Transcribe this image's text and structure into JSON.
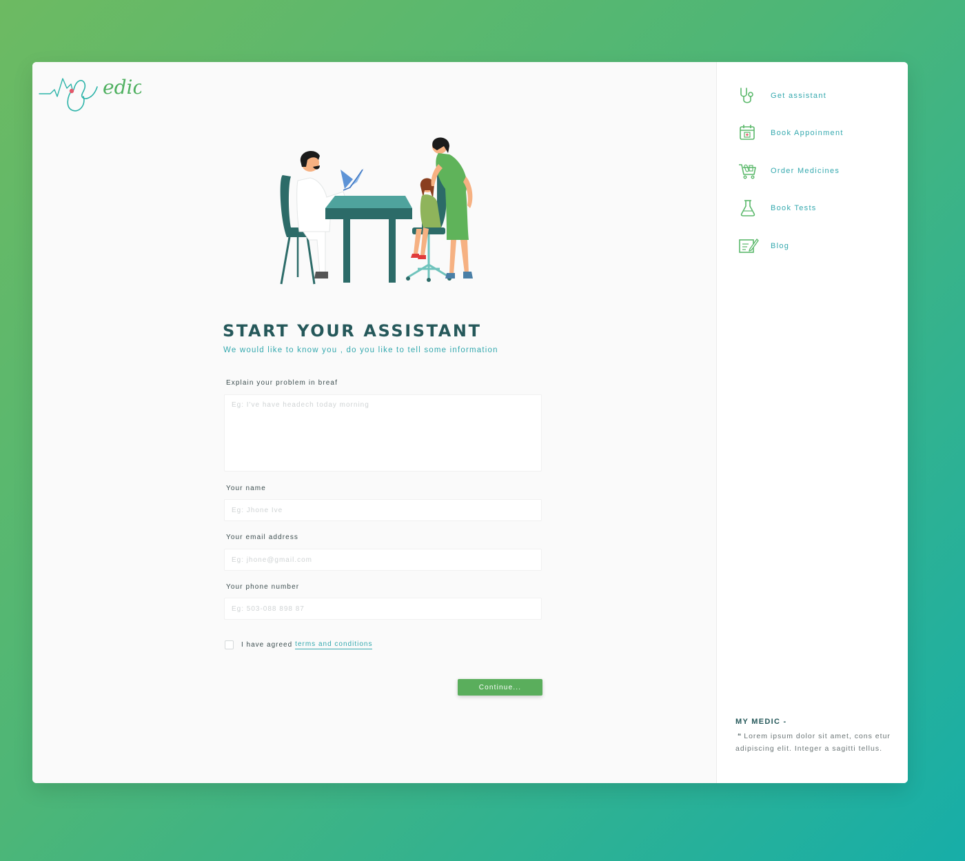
{
  "brand": {
    "logo_text": "Myedic"
  },
  "main": {
    "title": "START YOUR ASSISTANT",
    "subtitle": "We would like to know you , do you like to tell some information",
    "fields": {
      "problem": {
        "label": "Explain your problem in breaf",
        "placeholder": "Eg: I've have headech today morning"
      },
      "name": {
        "label": "Your name",
        "placeholder": "Eg: Jhone Ive"
      },
      "email": {
        "label": "Your email address",
        "placeholder": "Eg: jhone@gmail.com"
      },
      "phone": {
        "label": "Your phone number",
        "placeholder": "Eg: 503-088 898 87"
      }
    },
    "terms": {
      "checked": false,
      "text": "I have agreed",
      "link_text": "terms and conditions"
    },
    "continue_label": "Continue..."
  },
  "sidebar": {
    "items": [
      {
        "label": "Get assistant",
        "icon": "stethoscope-icon"
      },
      {
        "label": "Book Appoinment",
        "icon": "calendar-icon"
      },
      {
        "label": "Order Medicines",
        "icon": "cart-icon"
      },
      {
        "label": "Book Tests",
        "icon": "flask-icon"
      },
      {
        "label": "Blog",
        "icon": "note-pen-icon"
      }
    ],
    "quote": {
      "title": "MY MEDIC -",
      "mark": "“",
      "text": "Lorem ipsum dolor sit amet, cons etur adipiscing elit. Integer a sagitti tellus."
    }
  },
  "colors": {
    "accent_teal": "#33a8ae",
    "heading": "#25585a",
    "button_green": "#5aae5c",
    "background_gradient_start": "#6dba62",
    "background_gradient_end": "#17aea8"
  }
}
